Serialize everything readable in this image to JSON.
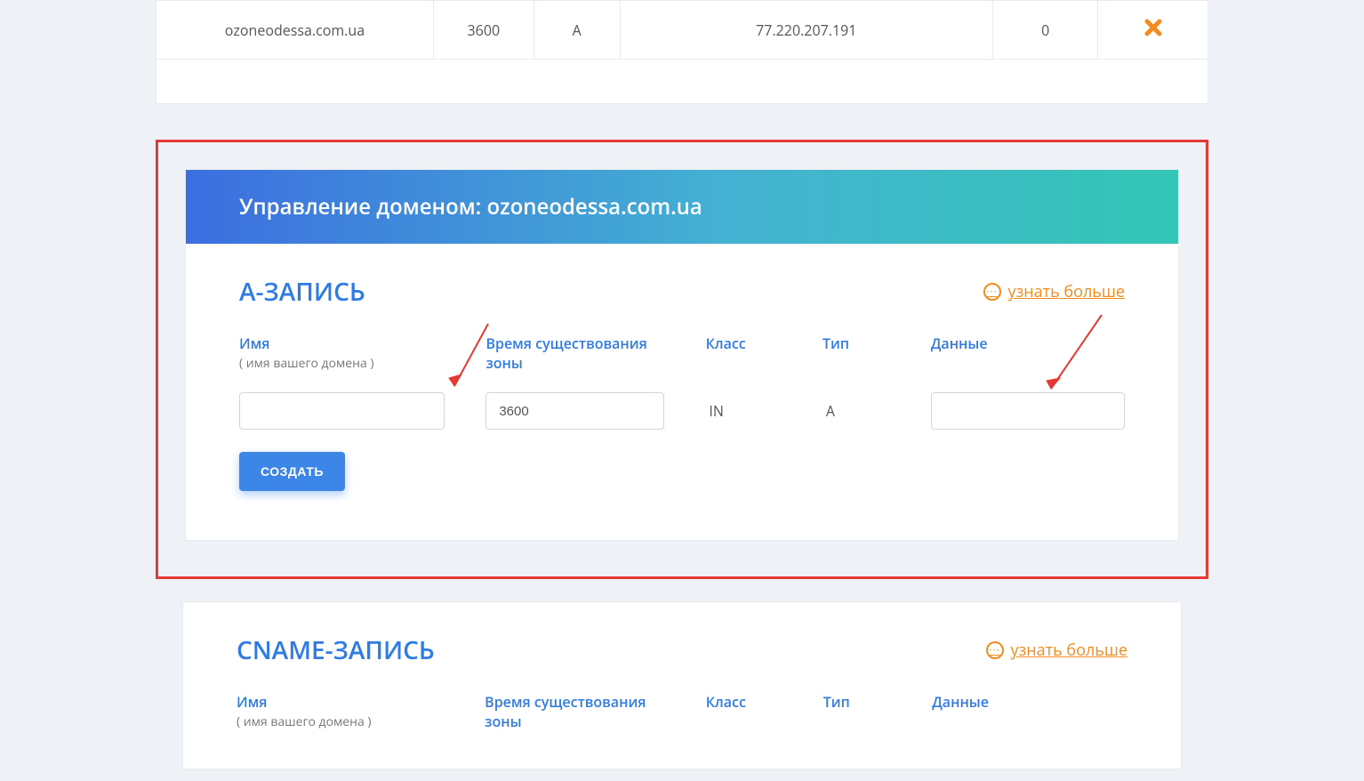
{
  "dns_row": {
    "name": "ozoneodessa.com.ua",
    "ttl": "3600",
    "type": "A",
    "data": "77.220.207.191",
    "priority": "0"
  },
  "panel": {
    "header": "Управление доменом: ozoneodessa.com.ua",
    "a_record": {
      "title": "A-ЗАПИСЬ",
      "learn_more": "узнать больше",
      "labels": {
        "name": "Имя",
        "name_sub": "( имя вашего домена )",
        "ttl": "Время существования зоны",
        "class": "Класс",
        "type": "Тип",
        "data": "Данные"
      },
      "values": {
        "ttl_input": "3600",
        "class_static": "IN",
        "type_static": "A"
      },
      "create_btn": "СОЗДАТЬ"
    },
    "cname_record": {
      "title": "CNAME-ЗАПИСЬ",
      "learn_more": "узнать больше",
      "labels": {
        "name": "Имя",
        "name_sub": "( имя вашего домена )",
        "ttl": "Время существования зоны",
        "class": "Класс",
        "type": "Тип",
        "data": "Данные"
      }
    }
  }
}
